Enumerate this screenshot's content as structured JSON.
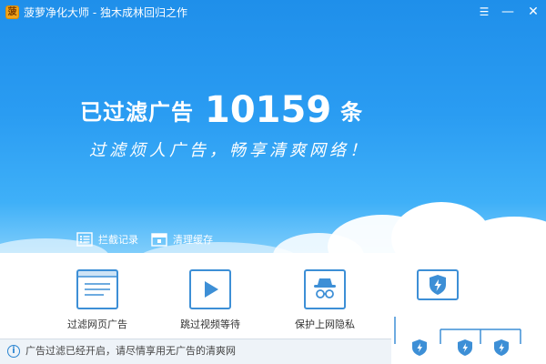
{
  "window": {
    "title": "菠萝净化大师 - 独木成林回归之作",
    "logo_glyph": "菠",
    "controls": {
      "menu": "☰",
      "minimize": "—",
      "close": "✕"
    }
  },
  "hero": {
    "filtered_label": "已过滤广告",
    "filtered_count": "10159",
    "filtered_unit": "条",
    "slogan": "过滤烦人广告，畅享清爽网络！",
    "links": [
      {
        "label": "拦截记录",
        "icon": "list-icon"
      },
      {
        "label": "清理缓存",
        "icon": "toolbox-icon"
      }
    ]
  },
  "features": [
    {
      "label": "过滤网页广告",
      "icon": "webpage-icon"
    },
    {
      "label": "跳过视频等待",
      "icon": "play-icon"
    },
    {
      "label": "保护上网隐私",
      "icon": "incognito-icon"
    },
    {
      "label": "",
      "icon": "shield-icon"
    }
  ],
  "status": {
    "icon": "info-icon",
    "text": "广告过滤已经开启，请尽情享用无广告的清爽网"
  },
  "colors": {
    "accent": "#3d8fd6",
    "hero_top": "#1f8fea",
    "hero_bottom": "#7fcdfb",
    "status_bg": "#eef3f8"
  }
}
